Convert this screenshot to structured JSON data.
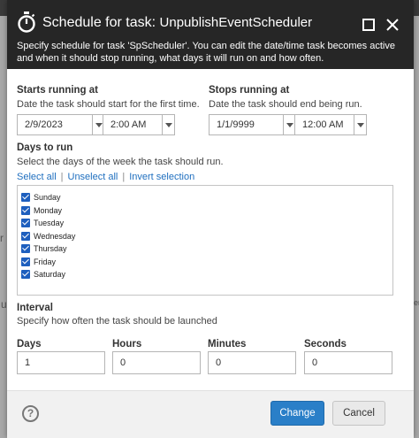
{
  "dialog": {
    "title_prefix": "Schedule for task:",
    "task_name": "UnpublishEventScheduler",
    "description": "Specify schedule for task 'SpScheduler'. You can edit the date/time task becomes active and when it should stop running, what days it will run on and how often."
  },
  "starts": {
    "label": "Starts running at",
    "hint": "Date the task should start for the first time.",
    "date": "2/9/2023",
    "time": "2:00 AM"
  },
  "stops": {
    "label": "Stops running at",
    "hint": "Date the task should end being run.",
    "date": "1/1/9999",
    "time": "12:00 AM"
  },
  "days": {
    "label": "Days to run",
    "hint": "Select the days of the week the task should run.",
    "select_all": "Select all",
    "unselect_all": "Unselect all",
    "invert": "Invert selection",
    "separator": "|",
    "items": [
      {
        "label": "Sunday",
        "checked": true
      },
      {
        "label": "Monday",
        "checked": true
      },
      {
        "label": "Tuesday",
        "checked": true
      },
      {
        "label": "Wednesday",
        "checked": true
      },
      {
        "label": "Thursday",
        "checked": true
      },
      {
        "label": "Friday",
        "checked": true
      },
      {
        "label": "Saturday",
        "checked": true
      }
    ]
  },
  "interval": {
    "label": "Interval",
    "hint": "Specify how often the task should be launched",
    "fields": [
      {
        "label": "Days",
        "value": "1"
      },
      {
        "label": "Hours",
        "value": "0"
      },
      {
        "label": "Minutes",
        "value": "0"
      },
      {
        "label": "Seconds",
        "value": "0"
      }
    ]
  },
  "footer": {
    "help": "?",
    "change_label": "Change",
    "cancel_label": "Cancel"
  },
  "backdrop": {
    "glyph_left_1": "r",
    "glyph_left_2": "u",
    "glyph_right": "len"
  },
  "colors": {
    "header_bg": "#262626",
    "accent": "#2a7fc8",
    "link": "#1f6fbf",
    "checkbox": "#1e5fbe"
  }
}
